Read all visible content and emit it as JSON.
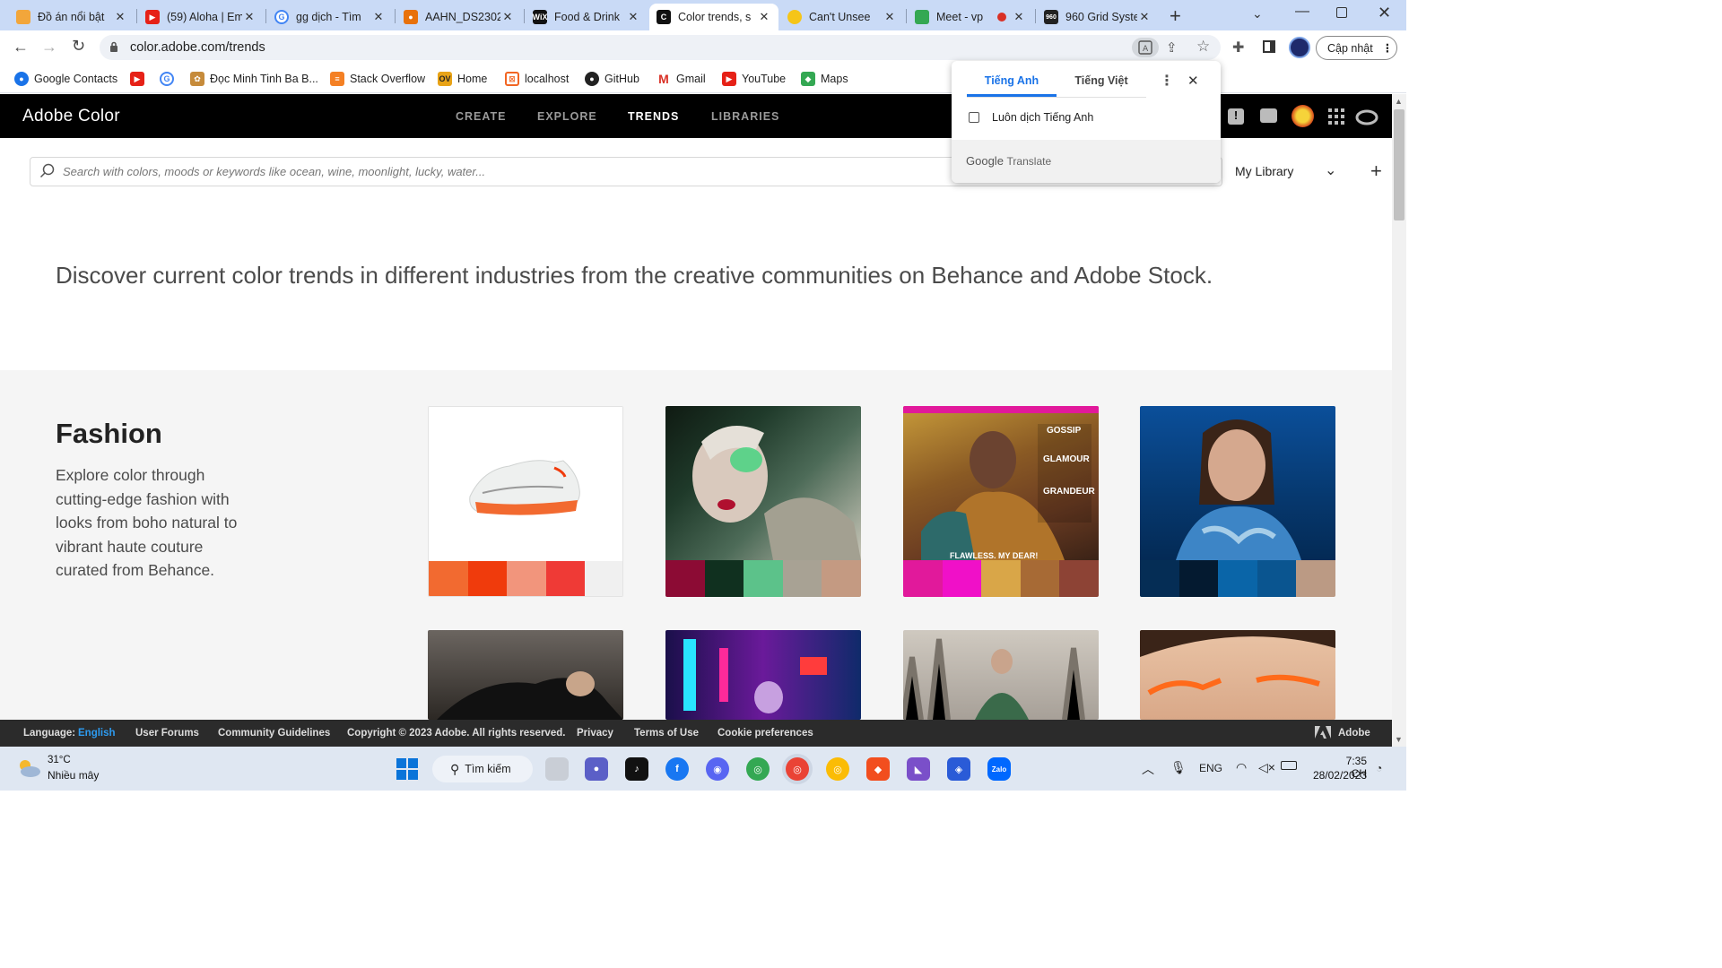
{
  "tabs": [
    {
      "title": "Đồ án nổi bật",
      "fav_color": "#f2a63b"
    },
    {
      "title": "(59) Aloha | Em",
      "fav_color": "#e62117"
    },
    {
      "title": "gg dịch - Tìm",
      "fav_color": "#4285f4"
    },
    {
      "title": "AAHN_DS2302",
      "fav_color": "#e8710a"
    },
    {
      "title": "Food & Drink",
      "fav_color": "#111111",
      "fav_text": "WiX"
    },
    {
      "title": "Color trends, s",
      "fav_color": "#111111",
      "fav_text": "C"
    },
    {
      "title": "Can't Unsee",
      "fav_color": "#f5c518"
    },
    {
      "title": "Meet - vp",
      "fav_color": "#34a853"
    },
    {
      "title": "960 Grid Syste",
      "fav_color": "#222222",
      "fav_text": "960"
    }
  ],
  "browser": {
    "url": "color.adobe.com/trends",
    "update_label": "Cập nhật"
  },
  "bookmarks": [
    {
      "label": "Google Contacts",
      "color": "#1a73e8"
    },
    {
      "label": "",
      "color": "#e62117"
    },
    {
      "label": "",
      "color": "#4285f4"
    },
    {
      "label": "Đọc Minh Tinh Ba B...",
      "color": "#c68b3b"
    },
    {
      "label": "Stack Overflow",
      "color": "#f48024"
    },
    {
      "label": "Home",
      "color": "#e8a317"
    },
    {
      "label": "localhost",
      "color": "#f26522"
    },
    {
      "label": "GitHub",
      "color": "#222222"
    },
    {
      "label": "Gmail",
      "color": "#d93025"
    },
    {
      "label": "YouTube",
      "color": "#e62117"
    },
    {
      "label": "Maps",
      "color": "#34a853"
    }
  ],
  "translate_popup": {
    "tab_source": "Tiếng Anh",
    "tab_target": "Tiếng Việt",
    "checkbox_label": "Luôn dịch Tiếng Anh",
    "brand": "Google",
    "brand_suffix": "Translate"
  },
  "adobe": {
    "logo": "Adobe Color",
    "nav": [
      "CREATE",
      "EXPLORE",
      "TRENDS",
      "LIBRARIES"
    ],
    "active_nav": "TRENDS",
    "search_placeholder": "Search with colors, moods or keywords like ocean, wine, moonlight, lucky, water...",
    "library_label": "My Library"
  },
  "intro": "Discover current color trends in different industries from the creative communities on Behance and Adobe Stock.",
  "section": {
    "title": "Fashion",
    "description": "Explore color through cutting-edge fashion with looks from boho natural to vibrant haute couture curated from Behance."
  },
  "cards": [
    {
      "image": "sneaker",
      "swatches": [
        "#f26a30",
        "#f03b0c",
        "#f2957c",
        "#ef3a36",
        "#f0f0f0"
      ]
    },
    {
      "image": "portrait-green",
      "swatches": [
        "#8c0b34",
        "#10301f",
        "#5cc28a",
        "#a8a294",
        "#c49a82"
      ]
    },
    {
      "image": "magazine-cover",
      "swatches": [
        "#e1199b",
        "#f010c8",
        "#d9a648",
        "#a76a35",
        "#8d4335"
      ]
    },
    {
      "image": "portrait-blue",
      "swatches": [
        "#052d55",
        "#041a30",
        "#0a65a8",
        "#0a5590",
        "#bb9a84"
      ]
    }
  ],
  "footer": {
    "language_label": "Language:",
    "language_value": "English",
    "links": [
      "User Forums",
      "Community Guidelines",
      "Copyright © 2023 Adobe. All rights reserved.",
      "Privacy",
      "Terms of Use",
      "Cookie preferences"
    ],
    "brand": "Adobe"
  },
  "taskbar": {
    "weather_temp": "31°C",
    "weather_desc": "Nhiều mây",
    "search_label": "Tìm kiếm",
    "lang": "ENG",
    "time": "7:35 CH",
    "date": "28/02/2023"
  },
  "colors": {
    "chrome_tabbar": "#c9daf6",
    "adobe_header": "#000000",
    "translate_accent": "#1a73e8"
  }
}
